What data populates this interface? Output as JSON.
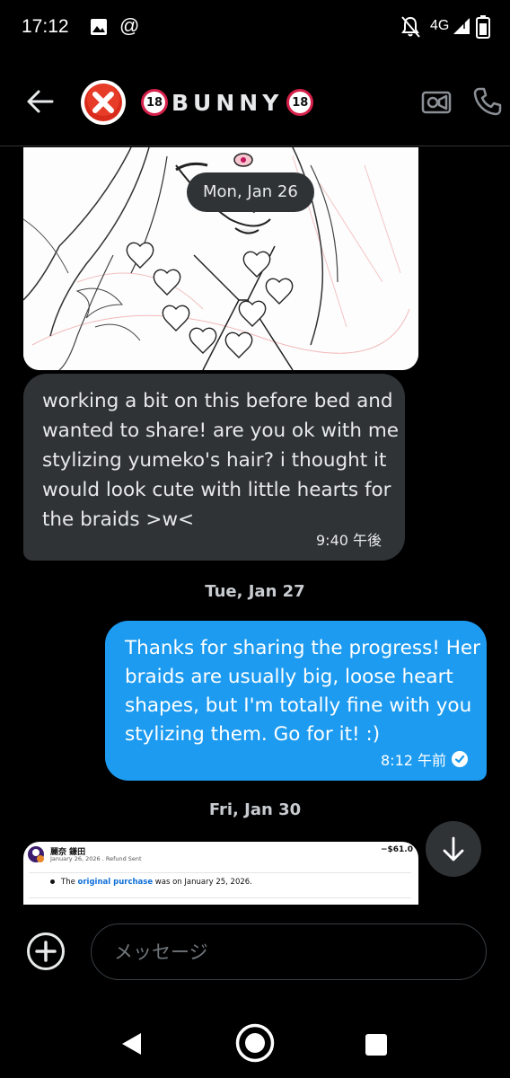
{
  "status_bar": {
    "time": "17:12",
    "at_symbol": "@",
    "network": "4G",
    "icons": [
      "image-icon",
      "mute-bell-icon",
      "signal-icon",
      "battery-icon"
    ]
  },
  "header": {
    "title": "BUNNY",
    "badge_left": "18",
    "badge_right": "18",
    "avatar_icon": "red-x-icon",
    "icons": [
      "back-arrow-icon",
      "video-call-icon",
      "phone-call-icon"
    ]
  },
  "conversation": {
    "date_jan26": "Mon, Jan 26",
    "received_message": "working a bit on this before bed and wanted to share! are you ok with me stylizing yumeko's hair? i thought it would look cute with little hearts for the braids >w<",
    "received_time": "9:40 午後",
    "date_jan27": "Tue, Jan 27",
    "sent_message": "Thanks for sharing the progress! Her braids are usually big, loose heart shapes, but I'm totally fine with you stylizing them. Go for it! :)",
    "sent_time": "8:12 午前",
    "date_jan30": "Fri, Jan 30"
  },
  "receipt_preview": {
    "name": "麗奈 鎌田",
    "subtitle": "January 26, 2026 . Refund Sent",
    "amount": "−$61.0",
    "line_prefix": "The ",
    "line_link": "original purchase",
    "line_suffix": " was on January 25, 2026."
  },
  "composer": {
    "placeholder": "メッセージ"
  },
  "colors": {
    "background": "#000000",
    "sent_bubble": "#1d9bf0",
    "received_bubble": "#2f3336",
    "link_blue": "#0d6ed8"
  }
}
